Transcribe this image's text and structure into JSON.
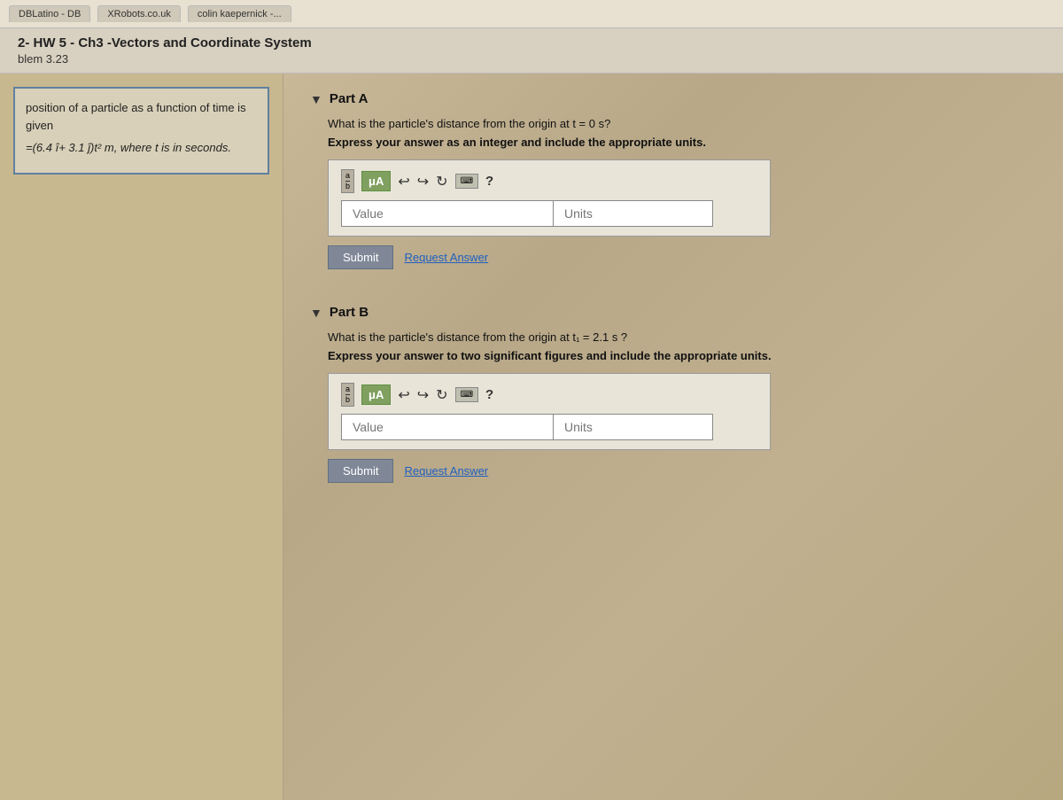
{
  "browser": {
    "tabs": [
      {
        "label": "DBLatino - DB",
        "active": false
      },
      {
        "label": "XRobots.co.uk",
        "active": false
      },
      {
        "label": "colin kaepernick -...",
        "active": false
      }
    ]
  },
  "page": {
    "title": "2- HW 5 - Ch3 -Vectors and Coordinate System",
    "problem_label": "blem 3.23"
  },
  "sidebar": {
    "problem_text_1": "position of a particle as a function of time is given",
    "problem_text_2": "=(6.4 î+ 3.1 ĵ)t² m, where t is in seconds."
  },
  "parts": {
    "part_a": {
      "title": "Part A",
      "question": "What is the particle's distance from the origin at t = 0 s?",
      "instruction": "Express your answer as an integer and include the appropriate units.",
      "toolbar": {
        "fraction_label": "fraction",
        "mu_label": "μA",
        "undo_symbol": "↩",
        "redo_symbol": "↪",
        "refresh_symbol": "↻",
        "keyboard_symbol": "⌨",
        "help_symbol": "?"
      },
      "value_placeholder": "Value",
      "units_placeholder": "Units",
      "submit_label": "Submit",
      "request_answer_label": "Request Answer"
    },
    "part_b": {
      "title": "Part B",
      "question": "What is the particle's distance from the origin at t₁ = 2.1 s ?",
      "instruction": "Express your answer to two significant figures and include the appropriate units.",
      "toolbar": {
        "fraction_label": "fraction",
        "mu_label": "μA",
        "undo_symbol": "↩",
        "redo_symbol": "↪",
        "refresh_symbol": "↻",
        "keyboard_symbol": "⌨",
        "help_symbol": "?"
      },
      "value_placeholder": "Value",
      "units_placeholder": "Units",
      "submit_label": "Submit",
      "request_answer_label": "Request Answer"
    }
  }
}
